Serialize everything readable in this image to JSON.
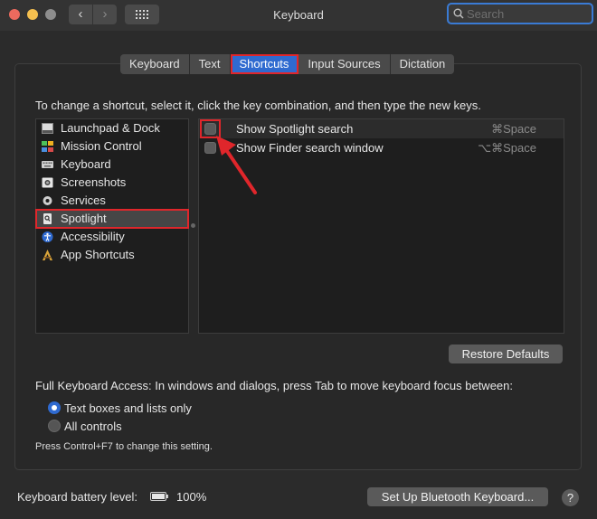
{
  "window": {
    "title": "Keyboard",
    "back_glyph": "‹",
    "forward_glyph": "›",
    "search_placeholder": "Search"
  },
  "tabs": [
    {
      "label": "Keyboard"
    },
    {
      "label": "Text"
    },
    {
      "label": "Shortcuts",
      "active": true
    },
    {
      "label": "Input Sources"
    },
    {
      "label": "Dictation"
    }
  ],
  "instructions": "To change a shortcut, select it, click the key combination, and then type the new keys.",
  "categories": [
    {
      "label": "Launchpad & Dock",
      "icon": "launchpad-icon"
    },
    {
      "label": "Mission Control",
      "icon": "mission-control-icon"
    },
    {
      "label": "Keyboard",
      "icon": "keyboard-icon"
    },
    {
      "label": "Screenshots",
      "icon": "screenshots-icon"
    },
    {
      "label": "Services",
      "icon": "gear-icon"
    },
    {
      "label": "Spotlight",
      "icon": "spotlight-icon",
      "selected": true
    },
    {
      "label": "Accessibility",
      "icon": "accessibility-icon"
    },
    {
      "label": "App Shortcuts",
      "icon": "app-shortcuts-icon"
    }
  ],
  "shortcuts": [
    {
      "label": "Show Spotlight search",
      "keys": "⌘Space",
      "checked": false
    },
    {
      "label": "Show Finder search window",
      "keys": "⌥⌘Space",
      "checked": false
    }
  ],
  "restore_defaults_label": "Restore Defaults",
  "full_keyboard_access": {
    "label": "Full Keyboard Access: In windows and dialogs, press Tab to move keyboard focus between:",
    "options": [
      {
        "label": "Text boxes and lists only",
        "selected": true
      },
      {
        "label": "All controls",
        "selected": false
      }
    ],
    "note": "Press Control+F7 to change this setting."
  },
  "footer": {
    "battery_label": "Keyboard battery level:",
    "battery_value": "100%",
    "bluetooth_button": "Set Up Bluetooth Keyboard...",
    "help_glyph": "?"
  },
  "colors": {
    "accent": "#2f6ad0",
    "highlight": "#e0262b"
  }
}
